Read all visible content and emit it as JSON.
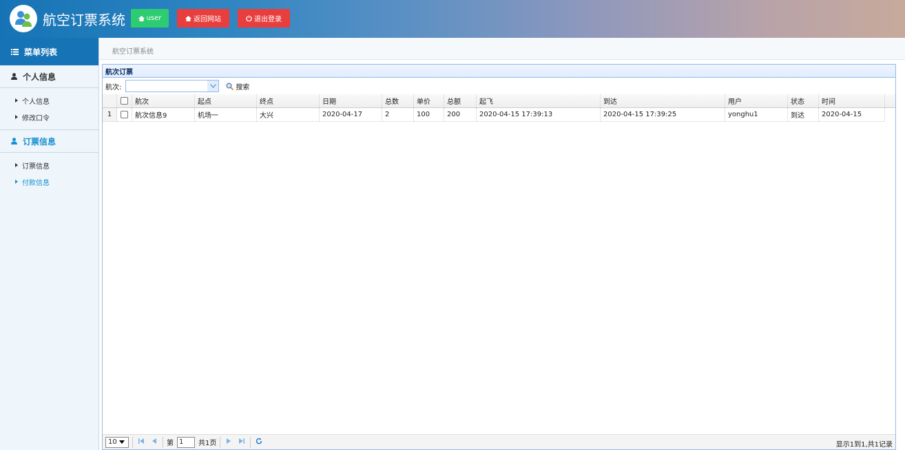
{
  "header": {
    "title": "航空订票系统",
    "user_label": "user",
    "back_label": "返回网站",
    "logout_label": "退出登录"
  },
  "sidebar": {
    "menu_title": "菜单列表",
    "groups": [
      {
        "label": "个人信息",
        "items": [
          "个人信息",
          "修改口令"
        ]
      },
      {
        "label": "订票信息",
        "items": [
          "订票信息",
          "付款信息"
        ]
      }
    ]
  },
  "breadcrumb": "航空订票系统",
  "panel": {
    "title": "航次订票",
    "filter_label": "航次:",
    "search_label": "搜索"
  },
  "table": {
    "columns": [
      "航次",
      "起点",
      "终点",
      "日期",
      "总数",
      "单价",
      "总额",
      "起飞",
      "到达",
      "用户",
      "状态",
      "时间"
    ],
    "rows": [
      {
        "num": "1",
        "cells": [
          "航次信息9",
          "机场一",
          "大兴",
          "2020-04-17",
          "2",
          "100",
          "200",
          "2020-04-15 17:39:13",
          "2020-04-15 17:39:25",
          "yonghu1",
          "到达",
          "2020-04-15"
        ]
      }
    ]
  },
  "pager": {
    "page_size": "10",
    "page_prefix": "第",
    "page_number": "1",
    "page_total": "共1页",
    "info": "显示1到1,共1记录"
  },
  "colors": {
    "accent": "#1673b5",
    "user_button": "#2ecc71",
    "danger_button": "#e83e3e",
    "panel_border": "#95b8e7"
  }
}
